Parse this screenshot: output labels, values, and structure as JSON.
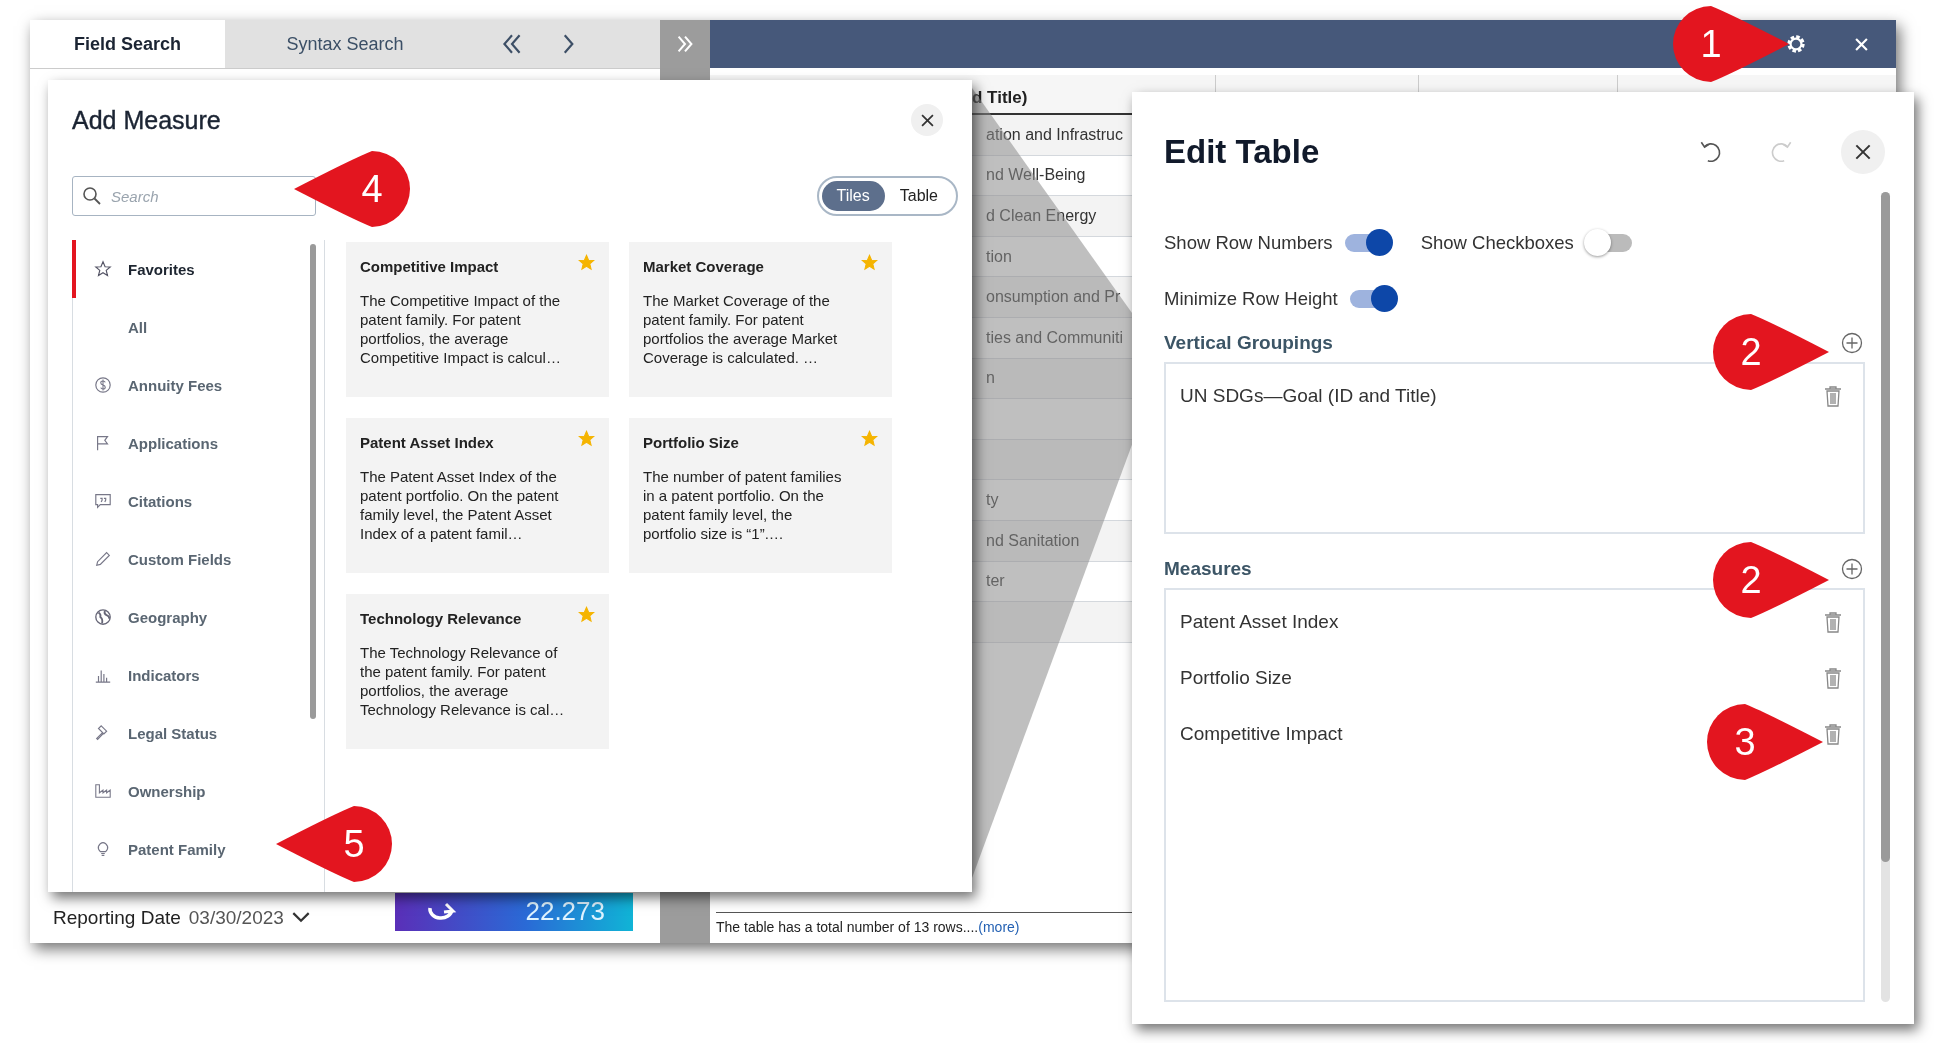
{
  "app": {
    "tabs": [
      {
        "label": "Field Search",
        "selected": true
      },
      {
        "label": "Syntax Search",
        "selected": false
      }
    ],
    "table": {
      "columns": [
        "d Title)"
      ],
      "rows": [
        {
          "text": "ation and Infrastruc"
        },
        {
          "text": "nd Well-Being"
        },
        {
          "text": "d Clean Energy"
        },
        {
          "text": "tion"
        },
        {
          "text": "onsumption and Pr"
        },
        {
          "text": "ties and Communiti"
        },
        {
          "text": "n"
        },
        {},
        {},
        {
          "text": "ty"
        },
        {
          "text": "nd Sanitation"
        },
        {
          "text": "ter"
        },
        {}
      ],
      "footer": "The table has a total number of 13 rows....",
      "footer_link": "(more)"
    },
    "reporting": {
      "label": "Reporting Date",
      "date": "03/30/2023"
    },
    "counter": "22.273"
  },
  "add_measure": {
    "title": "Add Measure",
    "search": {
      "placeholder": "Search"
    },
    "view_toggle": [
      {
        "label": "Tiles",
        "selected": true
      },
      {
        "label": "Table",
        "selected": false
      }
    ],
    "categories": [
      {
        "label": "Favorites",
        "selected": true
      },
      {
        "label": "All",
        "selected": false
      },
      {
        "label": "Annuity Fees",
        "selected": false
      },
      {
        "label": "Applications",
        "selected": false
      },
      {
        "label": "Citations",
        "selected": false
      },
      {
        "label": "Custom Fields",
        "selected": false
      },
      {
        "label": "Geography",
        "selected": false
      },
      {
        "label": "Indicators",
        "selected": false
      },
      {
        "label": "Legal Status",
        "selected": false
      },
      {
        "label": "Ownership",
        "selected": false
      },
      {
        "label": "Patent Family",
        "selected": false
      }
    ],
    "tiles": [
      {
        "title": "Competitive Impact",
        "description": "The Competitive Impact of the patent family. For patent portfolios, the average Competitive Impact is calcul…",
        "starred": true
      },
      {
        "title": "Market Coverage",
        "description": "The Market Coverage of the patent family. For patent portfolios the average Market Coverage is calculated. …",
        "starred": true
      },
      {
        "title": "Patent Asset Index",
        "description": "The Patent Asset Index of the patent portfolio. On the patent family level, the Patent Asset Index of a patent famil…",
        "starred": true
      },
      {
        "title": "Portfolio Size",
        "description": "The number of patent families in a patent portfolio. On the patent family level, the portfolio size is “1”.…",
        "starred": true
      },
      {
        "title": "Technology Relevance",
        "description": "The Technology Relevance of the patent family. For patent portfolios, the average Technology Relevance is cal…",
        "starred": true
      }
    ]
  },
  "edit_table": {
    "title": "Edit Table",
    "options": [
      {
        "label": "Show Row Numbers",
        "on": true
      },
      {
        "label": "Show Checkboxes",
        "on": false
      },
      {
        "label": "Minimize Row Height",
        "on": true
      }
    ],
    "vertical_groupings": {
      "heading": "Vertical Groupings",
      "items": [
        "UN SDGs—Goal (ID and Title)"
      ]
    },
    "measures": {
      "heading": "Measures",
      "items": [
        "Patent Asset Index",
        "Portfolio Size",
        "Competitive Impact"
      ]
    }
  },
  "annotations": [
    {
      "number": "1",
      "kind": "right"
    },
    {
      "number": "2",
      "kind": "right"
    },
    {
      "number": "2",
      "kind": "right"
    },
    {
      "number": "3",
      "kind": "right"
    },
    {
      "number": "4",
      "kind": "left"
    },
    {
      "number": "5",
      "kind": "left"
    }
  ]
}
